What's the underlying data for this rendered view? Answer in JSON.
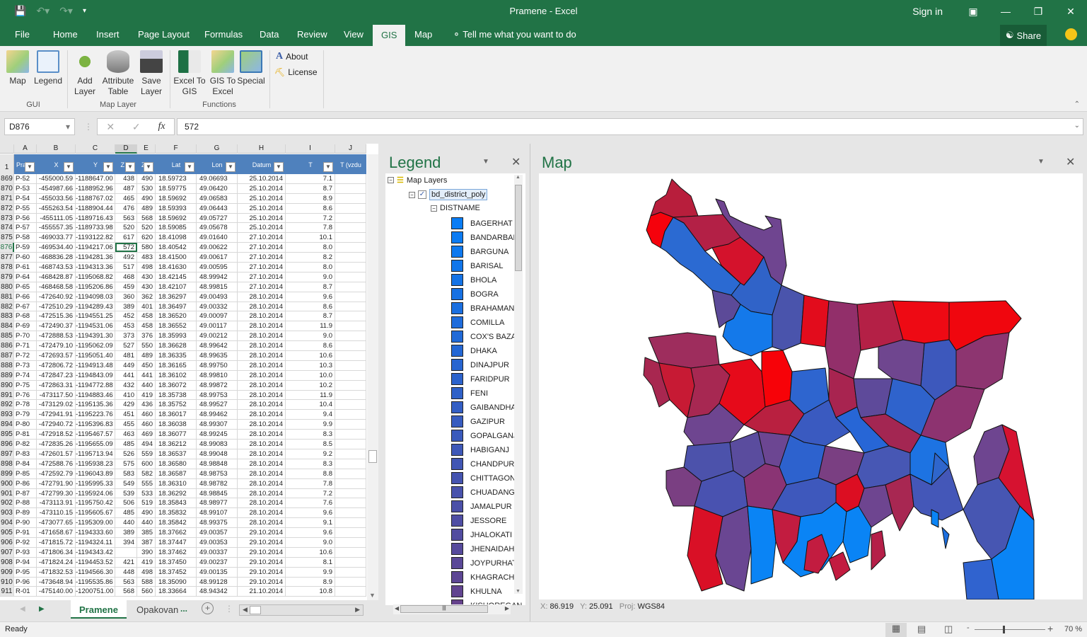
{
  "window": {
    "title": "Pramene  -  Excel",
    "sign_in": "Sign in"
  },
  "ribbon_tabs": [
    {
      "label": "File"
    },
    {
      "label": "Home"
    },
    {
      "label": "Insert"
    },
    {
      "label": "Page Layout"
    },
    {
      "label": "Formulas"
    },
    {
      "label": "Data"
    },
    {
      "label": "Review"
    },
    {
      "label": "View"
    },
    {
      "label": "GIS",
      "active": true
    },
    {
      "label": "Map"
    }
  ],
  "tell_me": "Tell me what you want to do",
  "share": "Share",
  "ribbon": {
    "gui": {
      "label": "GUI",
      "map": "Map",
      "legend": "Legend"
    },
    "map_layer": {
      "label": "Map Layer",
      "add": "Add Layer",
      "attr": "Attribute Table",
      "save": "Save Layer"
    },
    "functions": {
      "label": "Functions",
      "excel_to_gis": "Excel To GIS",
      "gis_to_excel": "GIS To Excel",
      "special": "Special"
    },
    "about": "About",
    "license": "License"
  },
  "formula_bar": {
    "name_box": "D876",
    "value": "572"
  },
  "sheet": {
    "columns": [
      "A",
      "B",
      "C",
      "D",
      "E",
      "F",
      "G",
      "H",
      "I",
      "J"
    ],
    "headers": [
      "Prame",
      "X",
      "Y",
      "Z (g",
      "Z (r",
      "Lat",
      "Lon",
      "Datum",
      "T",
      "T (vzdu"
    ],
    "header_row_num": "1",
    "rows": [
      [
        "869",
        "P-52",
        "-455000.59",
        "-1188647.00",
        "438",
        "490",
        "18.59723",
        "49.06693",
        "25.10.2014",
        "7.1"
      ],
      [
        "870",
        "P-53",
        "-454987.66",
        "-1188952.96",
        "487",
        "530",
        "18.59775",
        "49.06420",
        "25.10.2014",
        "8.7"
      ],
      [
        "871",
        "P-54",
        "-455033.56",
        "-1188767.02",
        "465",
        "490",
        "18.59692",
        "49.06583",
        "25.10.2014",
        "8.9"
      ],
      [
        "872",
        "P-55",
        "-455263.54",
        "-1188904.44",
        "476",
        "489",
        "18.59393",
        "49.06443",
        "25.10.2014",
        "8.6"
      ],
      [
        "873",
        "P-56",
        "-455111.05",
        "-1189716.43",
        "563",
        "568",
        "18.59692",
        "49.05727",
        "25.10.2014",
        "7.2"
      ],
      [
        "874",
        "P-57",
        "-455557.35",
        "-1189733.98",
        "520",
        "520",
        "18.59085",
        "49.05678",
        "25.10.2014",
        "7.8"
      ],
      [
        "875",
        "P-58",
        "-469033.77",
        "-1193122.82",
        "617",
        "620",
        "18.41098",
        "49.01640",
        "27.10.2014",
        "10.1"
      ],
      [
        "876",
        "P-59",
        "-469534.40",
        "-1194217.06",
        "572",
        "580",
        "18.40542",
        "49.00622",
        "27.10.2014",
        "8.0"
      ],
      [
        "877",
        "P-60",
        "-468836.28",
        "-1194281.36",
        "492",
        "483",
        "18.41500",
        "49.00617",
        "27.10.2014",
        "8.2"
      ],
      [
        "878",
        "P-61",
        "-468743.53",
        "-1194313.36",
        "517",
        "498",
        "18.41630",
        "49.00595",
        "27.10.2014",
        "8.0"
      ],
      [
        "879",
        "P-64",
        "-468428.87",
        "-1195068.82",
        "468",
        "430",
        "18.42145",
        "48.99942",
        "27.10.2014",
        "9.0"
      ],
      [
        "880",
        "P-65",
        "-468468.58",
        "-1195206.86",
        "459",
        "430",
        "18.42107",
        "48.99815",
        "27.10.2014",
        "8.7"
      ],
      [
        "881",
        "P-66",
        "-472640.92",
        "-1194098.03",
        "360",
        "362",
        "18.36297",
        "49.00493",
        "28.10.2014",
        "9.6"
      ],
      [
        "882",
        "P-67",
        "-472510.29",
        "-1194289.43",
        "389",
        "401",
        "18.36497",
        "49.00332",
        "28.10.2014",
        "8.6"
      ],
      [
        "883",
        "P-68",
        "-472515.36",
        "-1194551.25",
        "452",
        "458",
        "18.36520",
        "49.00097",
        "28.10.2014",
        "8.7"
      ],
      [
        "884",
        "P-69",
        "-472490.37",
        "-1194531.06",
        "453",
        "458",
        "18.36552",
        "49.00117",
        "28.10.2014",
        "11.9"
      ],
      [
        "885",
        "P-70",
        "-472888.53",
        "-1194391.30",
        "373",
        "376",
        "18.35993",
        "49.00212",
        "28.10.2014",
        "9.0"
      ],
      [
        "886",
        "P-71",
        "-472479.10",
        "-1195062.09",
        "527",
        "550",
        "18.36628",
        "48.99642",
        "28.10.2014",
        "8.6"
      ],
      [
        "887",
        "P-72",
        "-472693.57",
        "-1195051.40",
        "481",
        "489",
        "18.36335",
        "48.99635",
        "28.10.2014",
        "10.6"
      ],
      [
        "888",
        "P-73",
        "-472806.72",
        "-1194913.48",
        "449",
        "450",
        "18.36165",
        "48.99750",
        "28.10.2014",
        "10.3"
      ],
      [
        "889",
        "P-74",
        "-472847.23",
        "-1194843.09",
        "441",
        "441",
        "18.36102",
        "48.99810",
        "28.10.2014",
        "10.0"
      ],
      [
        "890",
        "P-75",
        "-472863.31",
        "-1194772.88",
        "432",
        "440",
        "18.36072",
        "48.99872",
        "28.10.2014",
        "10.2"
      ],
      [
        "891",
        "P-76",
        "-473117.50",
        "-1194883.46",
        "410",
        "419",
        "18.35738",
        "48.99753",
        "28.10.2014",
        "11.9"
      ],
      [
        "892",
        "P-78",
        "-473129.02",
        "-1195135.36",
        "429",
        "436",
        "18.35752",
        "48.99527",
        "28.10.2014",
        "10.4"
      ],
      [
        "893",
        "P-79",
        "-472941.91",
        "-1195223.76",
        "451",
        "460",
        "18.36017",
        "48.99462",
        "28.10.2014",
        "9.4"
      ],
      [
        "894",
        "P-80",
        "-472940.72",
        "-1195396.83",
        "455",
        "460",
        "18.36038",
        "48.99307",
        "28.10.2014",
        "9.9"
      ],
      [
        "895",
        "P-81",
        "-472918.52",
        "-1195467.57",
        "463",
        "469",
        "18.36077",
        "48.99245",
        "28.10.2014",
        "8.3"
      ],
      [
        "896",
        "P-82",
        "-472835.26",
        "-1195655.09",
        "485",
        "494",
        "18.36212",
        "48.99083",
        "28.10.2014",
        "8.5"
      ],
      [
        "897",
        "P-83",
        "-472601.57",
        "-1195713.94",
        "526",
        "559",
        "18.36537",
        "48.99048",
        "28.10.2014",
        "9.2"
      ],
      [
        "898",
        "P-84",
        "-472588.76",
        "-1195938.23",
        "575",
        "600",
        "18.36580",
        "48.98848",
        "28.10.2014",
        "8.3"
      ],
      [
        "899",
        "P-85",
        "-472592.79",
        "-1196043.89",
        "583",
        "582",
        "18.36587",
        "48.98753",
        "28.10.2014",
        "8.8"
      ],
      [
        "900",
        "P-86",
        "-472791.90",
        "-1195995.33",
        "549",
        "555",
        "18.36310",
        "48.98782",
        "28.10.2014",
        "7.8"
      ],
      [
        "901",
        "P-87",
        "-472799.30",
        "-1195924.06",
        "539",
        "533",
        "18.36292",
        "48.98845",
        "28.10.2014",
        "7.2"
      ],
      [
        "902",
        "P-88",
        "-473113.91",
        "-1195750.42",
        "506",
        "519",
        "18.35843",
        "48.98977",
        "28.10.2014",
        "7.6"
      ],
      [
        "903",
        "P-89",
        "-473110.15",
        "-1195605.67",
        "485",
        "490",
        "18.35832",
        "48.99107",
        "28.10.2014",
        "9.6"
      ],
      [
        "904",
        "P-90",
        "-473077.65",
        "-1195309.00",
        "440",
        "440",
        "18.35842",
        "48.99375",
        "28.10.2014",
        "9.1"
      ],
      [
        "905",
        "P-91",
        "-471658.67",
        "-1194333.60",
        "389",
        "385",
        "18.37662",
        "49.00357",
        "29.10.2014",
        "9.6"
      ],
      [
        "906",
        "P-92",
        "-471815.72",
        "-1194324.11",
        "394",
        "387",
        "18.37447",
        "49.00353",
        "29.10.2014",
        "9.0"
      ],
      [
        "907",
        "P-93",
        "-471806.34",
        "-1194343.42",
        "",
        "390",
        "18.37462",
        "49.00337",
        "29.10.2014",
        "10.6"
      ],
      [
        "908",
        "P-94",
        "-471824.24",
        "-1194453.52",
        "421",
        "419",
        "18.37450",
        "49.00237",
        "29.10.2014",
        "8.1"
      ],
      [
        "909",
        "P-95",
        "-471832.53",
        "-1194566.30",
        "448",
        "498",
        "18.37452",
        "49.00135",
        "29.10.2014",
        "9.9"
      ],
      [
        "910",
        "P-96",
        "-473648.94",
        "-1195535.86",
        "563",
        "588",
        "18.35090",
        "48.99128",
        "29.10.2014",
        "8.9"
      ],
      [
        "911",
        "R-01",
        "-475140.00",
        "-1200751.00",
        "568",
        "560",
        "18.33664",
        "48.94342",
        "21.10.2014",
        "10.8"
      ]
    ],
    "tabs": [
      {
        "label": "Pramene",
        "active": true
      },
      {
        "label": "Opakovan"
      }
    ],
    "tabs_more": "..."
  },
  "legend": {
    "title": "Legend",
    "root": "Map Layers",
    "layer": "bd_district_poly",
    "field": "DISTNAME",
    "items": [
      {
        "name": "BAGERHAT",
        "color": "#0a7df5"
      },
      {
        "name": "BANDARBAN",
        "color": "#0c7bf2"
      },
      {
        "name": "BARGUNA",
        "color": "#0e79ef"
      },
      {
        "name": "BARISAL",
        "color": "#1176ea"
      },
      {
        "name": "BHOLA",
        "color": "#1473e6"
      },
      {
        "name": "BOGRA",
        "color": "#1771e3"
      },
      {
        "name": "BRAHAMANB",
        "color": "#1a6fe0"
      },
      {
        "name": "COMILLA",
        "color": "#1e6cdc"
      },
      {
        "name": "COX'S BAZAR",
        "color": "#216ad8"
      },
      {
        "name": "DHAKA",
        "color": "#2467d4"
      },
      {
        "name": "DINAJPUR",
        "color": "#2865d0"
      },
      {
        "name": "FARIDPUR",
        "color": "#2c63cc"
      },
      {
        "name": "FENI",
        "color": "#2f61c8"
      },
      {
        "name": "GAIBANDHA",
        "color": "#335ec4"
      },
      {
        "name": "GAZIPUR",
        "color": "#375cc0"
      },
      {
        "name": "GOPALGANJ",
        "color": "#3a5abc"
      },
      {
        "name": "HABIGANJ",
        "color": "#3e58b8"
      },
      {
        "name": "CHANDPUR",
        "color": "#4156b4"
      },
      {
        "name": "CHITTAGONG",
        "color": "#4554b0"
      },
      {
        "name": "CHUADANGA",
        "color": "#4852ac"
      },
      {
        "name": "JAMALPUR",
        "color": "#4b50a8"
      },
      {
        "name": "JESSORE",
        "color": "#4f4ea4"
      },
      {
        "name": "JHALOKATI",
        "color": "#524ca0"
      },
      {
        "name": "JHENAIDAH",
        "color": "#564a9c"
      },
      {
        "name": "JOYPURHAT",
        "color": "#5a4898"
      },
      {
        "name": "KHAGRACHH",
        "color": "#5d4694"
      },
      {
        "name": "KHULNA",
        "color": "#614490"
      },
      {
        "name": "KISHOREGAN",
        "color": "#65428c"
      }
    ]
  },
  "map": {
    "title": "Map",
    "x_label": "X:",
    "x_value": "86.919",
    "y_label": "Y:",
    "y_value": "25.091",
    "proj_label": "Proj:",
    "proj_value": "WGS84"
  },
  "status": {
    "ready": "Ready",
    "zoom": "70 %",
    "zoom_fraction": 0.4
  }
}
